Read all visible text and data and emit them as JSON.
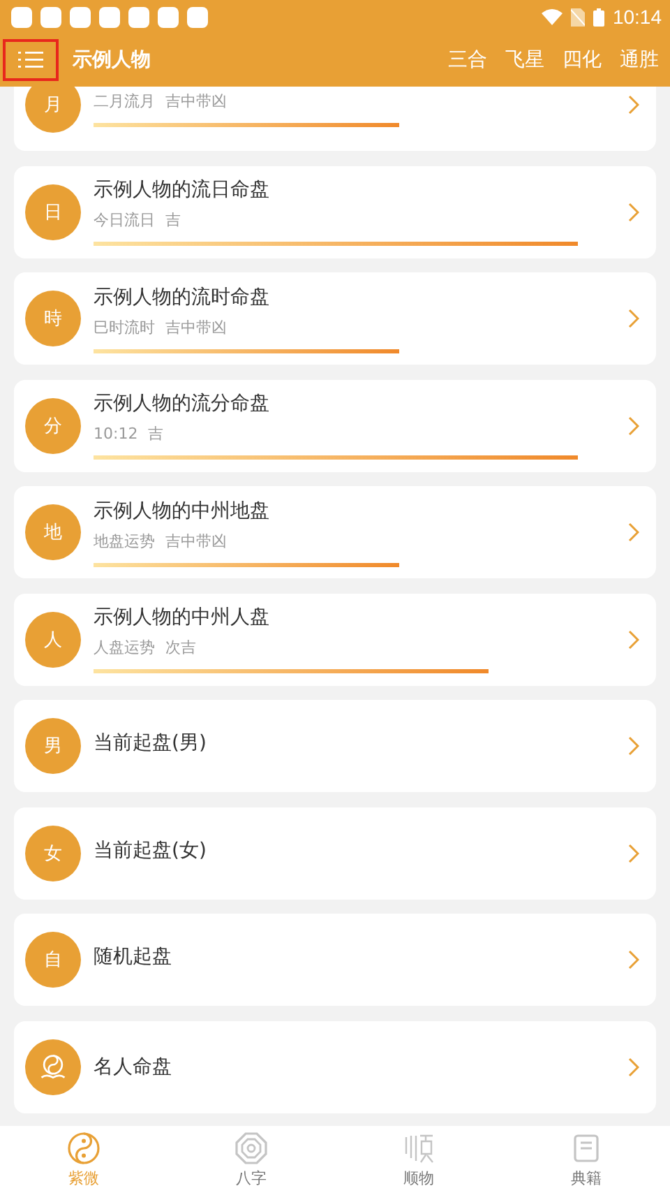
{
  "status_bar": {
    "time": "10:14"
  },
  "header": {
    "title": "示例人物",
    "tabs": [
      "三合",
      "飞星",
      "四化",
      "通胜"
    ]
  },
  "cards": [
    {
      "kind": "letter",
      "badge": "月",
      "subtitle": "二月流月 吉中带凶"
    },
    {
      "kind": "letter",
      "badge": "日",
      "title": "示例人物的流日命盘",
      "subtitle": "今日流日 吉"
    },
    {
      "kind": "letter",
      "badge": "時",
      "title": "示例人物的流时命盘",
      "subtitle": "巳时流时 吉中带凶"
    },
    {
      "kind": "letter",
      "badge": "分",
      "title": "示例人物的流分命盘",
      "subtitle": "10:12 吉"
    },
    {
      "kind": "letter",
      "badge": "地",
      "title": "示例人物的中州地盘",
      "subtitle": "地盘运势 吉中带凶"
    },
    {
      "kind": "letter",
      "badge": "人",
      "title": "示例人物的中州人盘",
      "subtitle": "人盘运势 次吉"
    },
    {
      "kind": "letter",
      "badge": "男",
      "title": "当前起盘(男)"
    },
    {
      "kind": "letter",
      "badge": "女",
      "title": "当前起盘(女)"
    },
    {
      "kind": "letter",
      "badge": "自",
      "title": "随机起盘"
    },
    {
      "kind": "icon",
      "title": "名人命盘"
    }
  ],
  "nav": [
    {
      "label": "紫微",
      "selected": true
    },
    {
      "label": "八字",
      "selected": false
    },
    {
      "label": "顺物",
      "selected": false
    },
    {
      "label": "典籍",
      "selected": false
    }
  ]
}
